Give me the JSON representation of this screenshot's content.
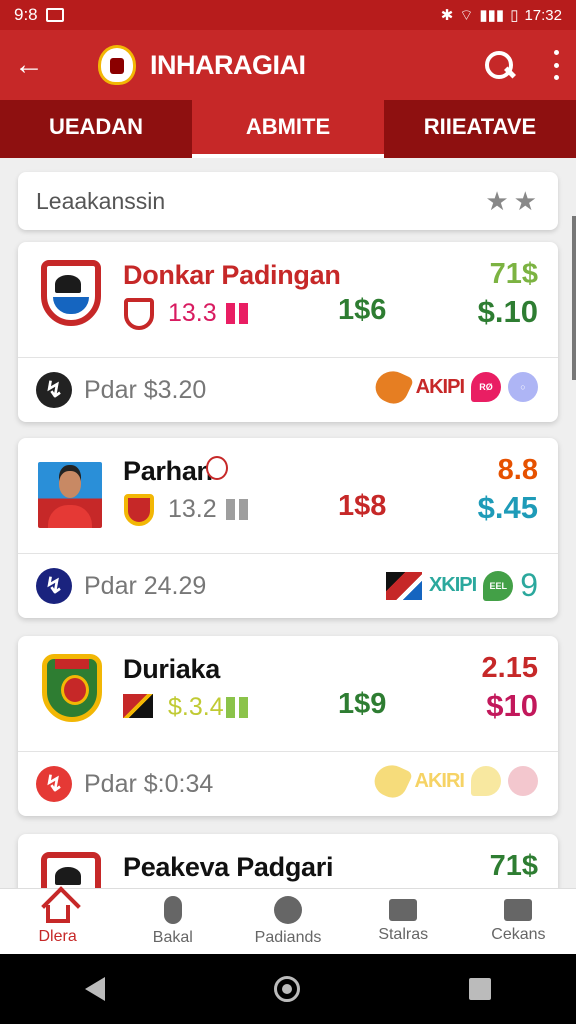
{
  "status": {
    "left_time": "9:8",
    "right_time": "17:32"
  },
  "app_bar": {
    "title": "INHARAGIAI"
  },
  "tabs": [
    "UEADAN",
    "ABMITE",
    "RIIEATAVE"
  ],
  "search": {
    "text": "Leaakanssin"
  },
  "cards": [
    {
      "name": "Donkar Padingan",
      "name_color": "#c62828",
      "stat": "13.3",
      "stat_color": "#d81b60",
      "bar_color": "#e91e63",
      "mid_price": "1$6",
      "mid_color": "#2e7d32",
      "right_top": "71$",
      "right_top_color": "#7cb342",
      "right_bottom": "$.10",
      "right_bottom_color": "#2e7d32",
      "pdar": "Pdar $3.20",
      "pdar_icon_color": "#222222",
      "akipi": "AKIPI",
      "akipi_color": "#c62828"
    },
    {
      "name": "Parhan",
      "name_color": "#111111",
      "stat": "13.2",
      "stat_color": "#777777",
      "bar_color": "#9e9e9e",
      "mid_price": "1$8",
      "mid_color": "#c62828",
      "right_top": "8.8",
      "right_top_color": "#e65100",
      "right_bottom": "$.45",
      "right_bottom_color": "#1e9bb8",
      "pdar": "Pdar 24.29",
      "pdar_icon_color": "#1a237e",
      "akipi": "XKIPI",
      "akipi_color": "#2ba89d"
    },
    {
      "name": "Duriaka",
      "name_color": "#111111",
      "stat": "$.3.4",
      "stat_color": "#c0ca33",
      "bar_color": "#8bc34a",
      "mid_price": "1$9",
      "mid_color": "#2e7d32",
      "right_top": "2.15",
      "right_top_color": "#c62828",
      "right_bottom": "$10",
      "right_bottom_color": "#c2185b",
      "pdar": "Pdar $:0:34",
      "pdar_icon_color": "#e53935",
      "akipi": "AKIRI",
      "akipi_color": "#f6d365"
    },
    {
      "name": "Peakeva Padgari",
      "name_color": "#111111",
      "right_top": "71$",
      "right_top_color": "#2e7d32"
    }
  ],
  "nav": [
    "Dlera",
    "Bakal",
    "Padiands",
    "Stalras",
    "Cekans"
  ],
  "icons": [
    "back-arrow-icon",
    "search-icon",
    "more-vertical-icon",
    "star-icon",
    "home-icon",
    "mic-icon",
    "compass-icon",
    "stats-icon",
    "list-icon"
  ]
}
